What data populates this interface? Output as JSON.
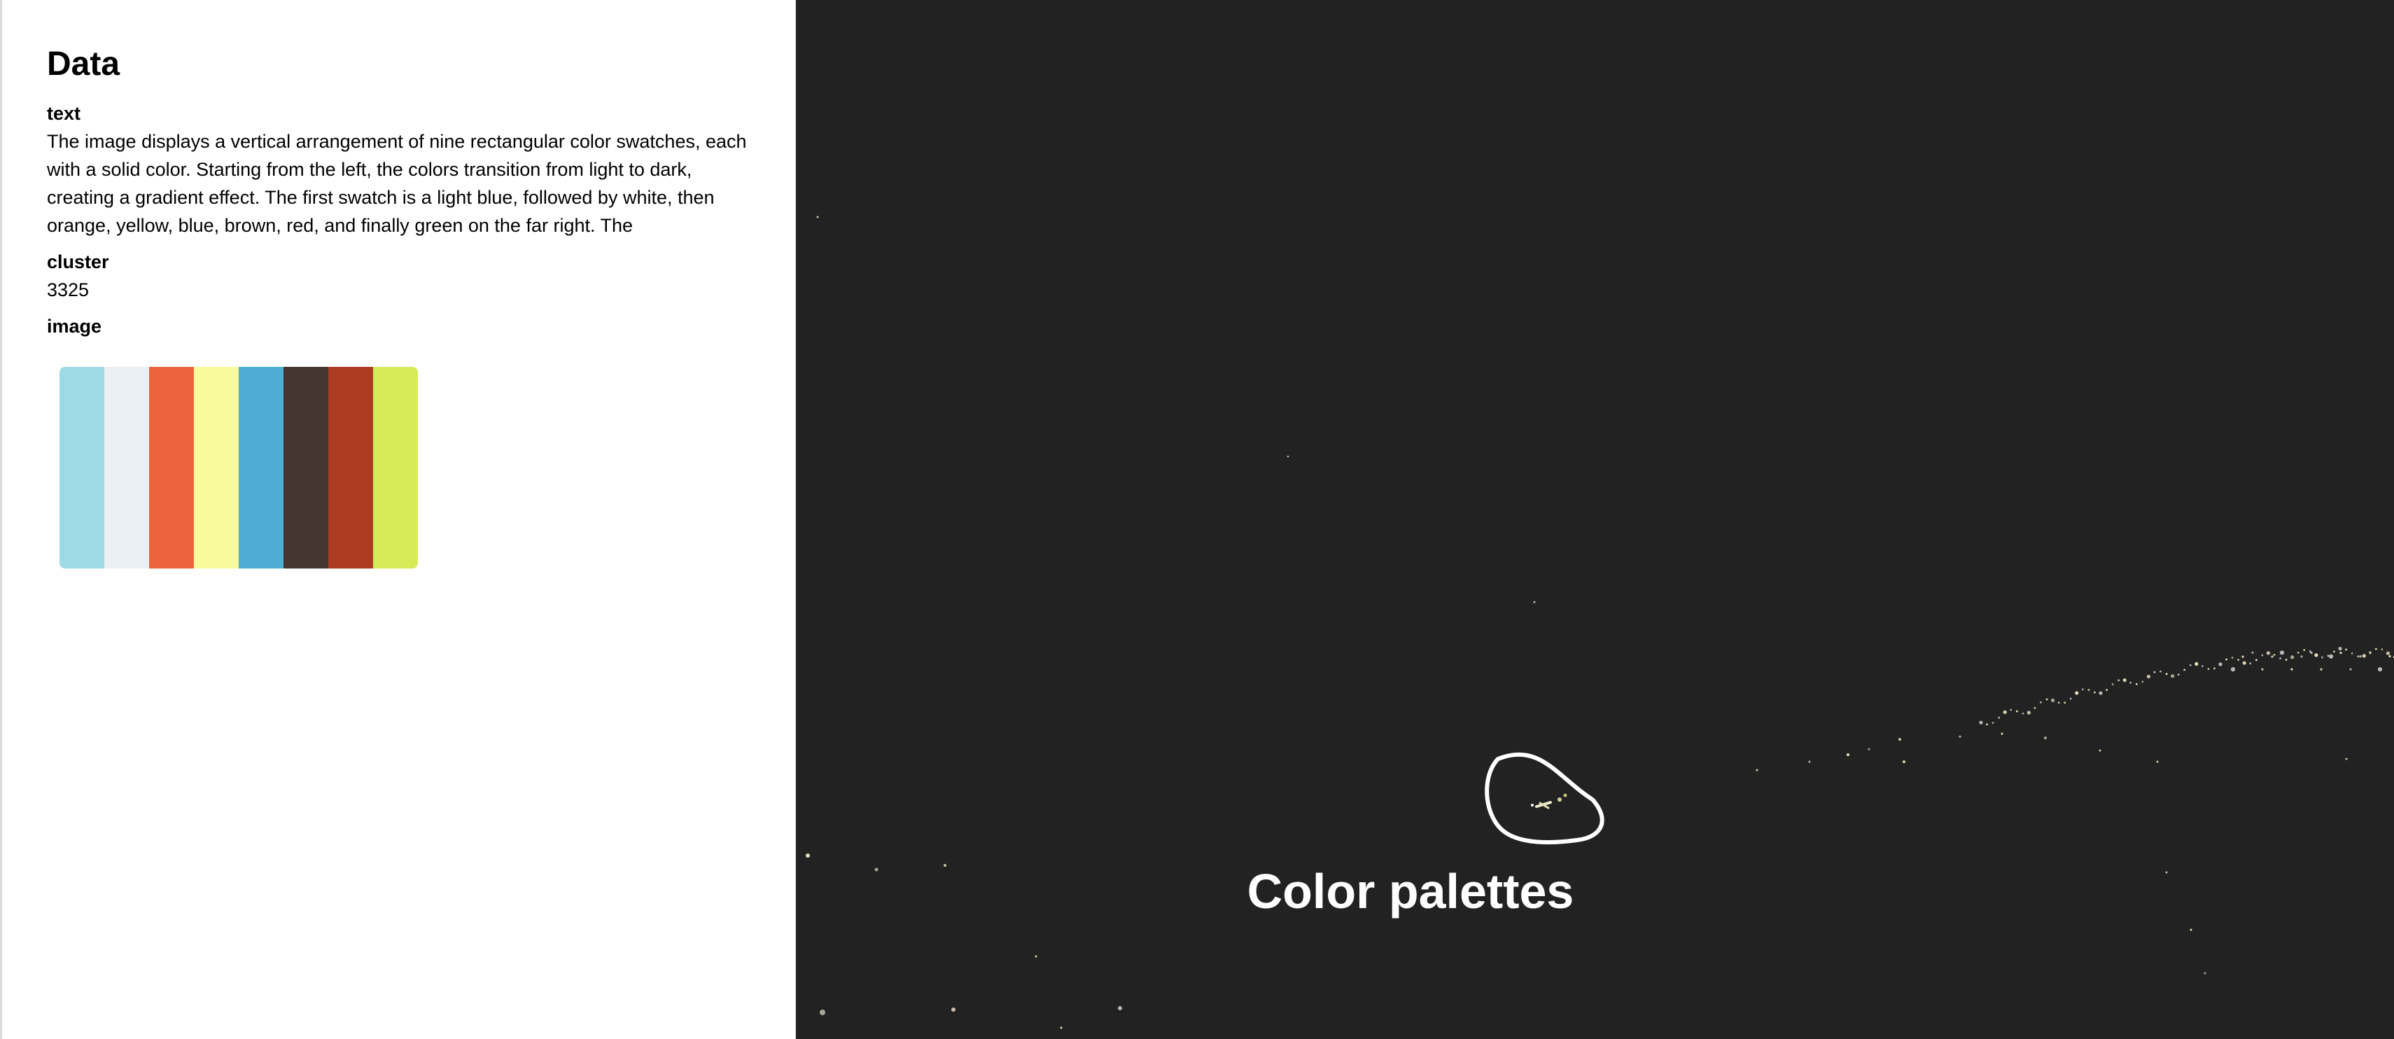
{
  "panel": {
    "title": "Data",
    "fields": {
      "text_label": "text",
      "text_value": "The image displays a vertical arrangement of nine rectangular color swatches, each with a solid color. Starting from the left, the colors transition from light to dark, creating a gradient effect. The first swatch is a light blue, followed by white, then orange, yellow, blue, brown, red, and finally green on the far right. The",
      "cluster_label": "cluster",
      "cluster_value": "3325",
      "image_label": "image"
    },
    "swatch_colors": [
      "#9ddae6",
      "#eaf0f3",
      "#ec643b",
      "#f8fb9c",
      "#4eadd3",
      "#453531",
      "#ac3b22",
      "#d6eb58"
    ]
  },
  "map": {
    "cluster_label": "Color palettes",
    "background_color": "#222222",
    "highlight_icon": "circle-outline"
  }
}
